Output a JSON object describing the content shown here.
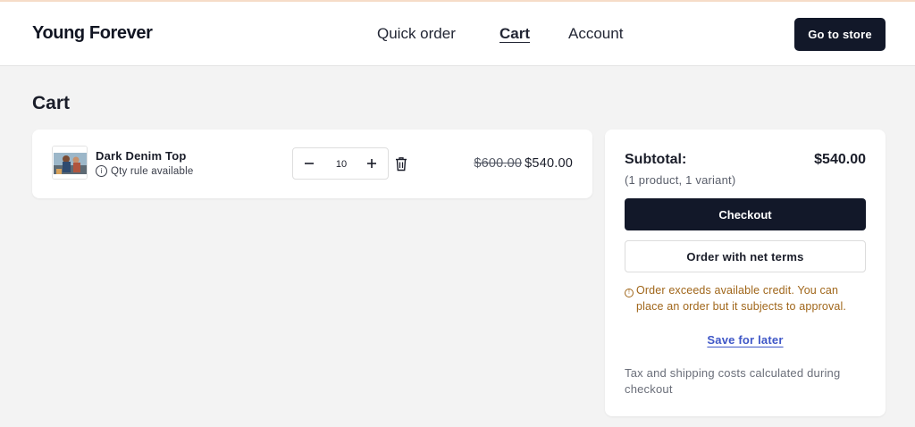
{
  "header": {
    "brand": "Young Forever",
    "nav": [
      {
        "label": "Quick order"
      },
      {
        "label": "Cart"
      },
      {
        "label": "Account"
      }
    ],
    "store_button": "Go to store"
  },
  "page": {
    "title": "Cart"
  },
  "cart": {
    "items": [
      {
        "name": "Dark Denim Top",
        "rule_text": "Qty rule available",
        "quantity": "10",
        "original_price": "$600.00",
        "price": "$540.00"
      }
    ]
  },
  "summary": {
    "subtotal_label": "Subtotal:",
    "subtotal_value": "$540.00",
    "count_note": "(1 product, 1 variant)",
    "checkout_label": "Checkout",
    "net_terms_label": "Order with net terms",
    "warning_line1": "Order exceeds available credit. You can",
    "warning_line2": "place an order but it subjects to approval.",
    "save_later_label": "Save for later",
    "tax_note": "Tax and shipping costs calculated during checkout"
  },
  "colors": {
    "primary": "#121829",
    "background": "#f3f3f3",
    "warning": "#a0661a",
    "link": "#3f57c7",
    "top_accent": "#f6dcc8"
  },
  "icons": {
    "info": "info-icon",
    "minus": "minus-icon",
    "plus": "plus-icon",
    "trash": "trash-icon",
    "warning": "warning-icon"
  }
}
